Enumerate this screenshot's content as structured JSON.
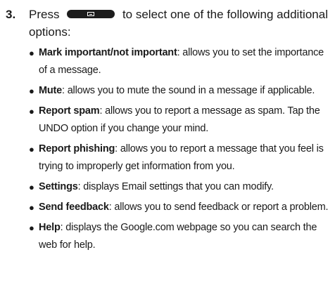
{
  "step": {
    "number": "3.",
    "text_before": "Press",
    "text_after": "to select one of the following additional options:"
  },
  "icons": {
    "menu_key": "menu-key-icon"
  },
  "options": [
    {
      "term": "Mark important/not important",
      "description": ": allows you to set the importance of a message."
    },
    {
      "term": "Mute",
      "description": ": allows you to mute the sound in a message if applicable."
    },
    {
      "term": "Report spam",
      "description": ": allows you to report a message as spam. Tap the UNDO option if you change your mind."
    },
    {
      "term": "Report phishing",
      "description": ": allows you to report a message that you feel is trying to improperly get information from you."
    },
    {
      "term": "Settings",
      "description": ": displays Email settings that you can modify."
    },
    {
      "term": "Send feedback",
      "description": ": allows you to send feedback or report a problem."
    },
    {
      "term": "Help",
      "description": ": displays the Google.com webpage so you can search the web for help."
    }
  ]
}
